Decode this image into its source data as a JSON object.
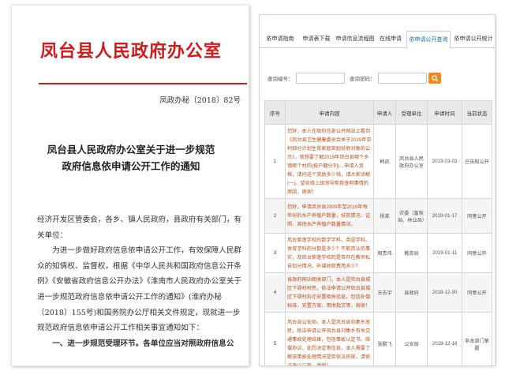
{
  "document": {
    "header": "凤台县人民政府办公室",
    "number": "凤政办秘〔2018〕82号",
    "title_line1": "凤台县人民政府办公室关于进一步规范",
    "title_line2": "政府信息依申请公开工作的通知",
    "salutation": "经济开发区管委会，各乡、镇人民政府，县政府有关部门，有关单位：",
    "para1": "为进一步做好政府信息依申请公开工作，有效保障人民群众的知情权、监督权，根据《中华人民共和国政府信息公开条例》《安徽省政府信息公开办法》《淮南市人民政府办公室关于进一步规范政府信息依申请公开工作的通知》(淮府办秘〔2018〕155号)和国务院办公厅相关文件规定，现就进一步规范政府信息依申请公开工作相关事宜通知如下：",
    "section1": "一、进一步规范受理环节。各单位应当对照政府信息公"
  },
  "portal": {
    "tabs": [
      {
        "label": "依申请指南"
      },
      {
        "label": "申请表下载"
      },
      {
        "label": "申请信息流程图"
      },
      {
        "label": "在线申请"
      },
      {
        "label": "依申请公开查询"
      },
      {
        "label": "依申请公开统计"
      }
    ],
    "search": {
      "label1": "查询编号：",
      "label2": "查询密码：",
      "button_icon": "search-icon"
    },
    "table": {
      "headers": [
        "序号",
        "申请内容",
        "申请人",
        "受理单位",
        "申请时间",
        "当前状态"
      ],
      "rows": [
        {
          "no": "1",
          "content": "您好，本人在政府信息公开网站上看到《凤台县卫生健康委员会关于2019年农村部分计划生育家庭奖励扶助对象的公示》，我想要了解2019年凤台县哪个乡镇哪个村的(按户籍分列)…申请人资格，请问这个奖励多少钱，请大家谅解(一)。望各级上级领导帮我查明事情的原因，谢谢！",
          "applicant": "韩凯",
          "unit": "凤台县人民政府办公室",
          "date": "2019-03-03",
          "status": "已告知公开"
        },
        {
          "no": "2",
          "content": "您好，申请凤台县2000年至2019年每年份的水产养殖户数量，扶贫情况、证照、其他水产养殖户数量情况。",
          "applicant": "杨某",
          "unit": "农委（畜牧局、林业局）",
          "date": "2019-01-17",
          "status": "同意公开"
        },
        {
          "no": "3",
          "content": "凤台紫蓬学校的数学学科、英语学科、体育学科的分数是多少？不能否认的事实，及凤台紫蓬学校的是否存在教师私自加分情况，补课收取费用多少？",
          "applicant": "周贵伟",
          "unit": "教育局",
          "date": "2019-01-11",
          "status": "同意公开"
        },
        {
          "no": "4",
          "content": "县政府网站相关部门，本人是凤台县城区下郢村村民，依法申请公开凤台县城区下郢村拆迁安置相关信息，包括补偿标准、安置方案、用地批文等，谢谢！",
          "applicant": "王志宇",
          "unit": "县政府",
          "date": "2018-12-30",
          "status": "同意公开"
        },
        {
          "no": "5",
          "content": "凤台县公安局，本人是凤台县刘集乡居民，依法申请公开凤台县刘集乡有关交通事故处理结果，包括事故认定书、赔偿协议、处罚决定等信息，本人需要了解该事故处理情况是否依法依规，请依法予以公开，谢谢！",
          "applicant": "张鹏飞",
          "unit": "公安局",
          "date": "2018-12-18",
          "status": "非本部门掌握"
        }
      ]
    }
  }
}
